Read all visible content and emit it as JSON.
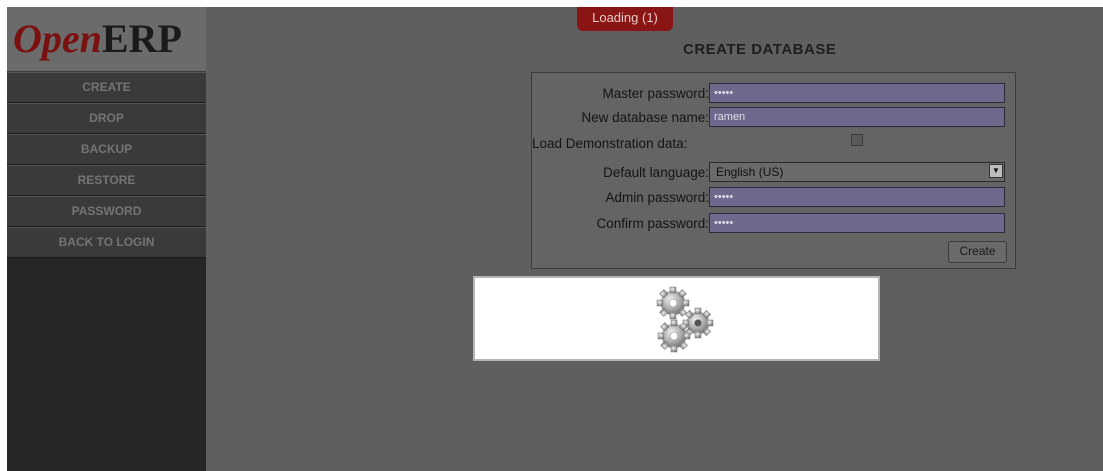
{
  "app": {
    "logo": {
      "open": "Open",
      "erp": "ERP"
    },
    "loading_badge": "Loading (1)"
  },
  "sidebar": {
    "items": [
      {
        "label": "CREATE"
      },
      {
        "label": "DROP"
      },
      {
        "label": "BACKUP"
      },
      {
        "label": "RESTORE"
      },
      {
        "label": "PASSWORD"
      },
      {
        "label": "BACK TO LOGIN"
      }
    ]
  },
  "form": {
    "title": "CREATE DATABASE",
    "fields": {
      "master_password": {
        "label": "Master password:",
        "value": "•••••"
      },
      "db_name": {
        "label": "New database name:",
        "value": "ramen"
      },
      "demo_data": {
        "label": "Load Demonstration data:",
        "checked": false
      },
      "language": {
        "label": "Default language:",
        "value": "English (US)"
      },
      "admin_password": {
        "label": "Admin password:",
        "value": "•••••"
      },
      "confirm_password": {
        "label": "Confirm password:",
        "value": "•••••"
      }
    },
    "create_label": "Create"
  },
  "colors": {
    "overlay_bg": "#5f5f5f",
    "loading_red": "#8a1515",
    "logo_red": "#7a1010",
    "input_bg": "#6e6a8e"
  },
  "icons": {
    "spinner": "gears-icon",
    "dropdown": "chevron-down-icon"
  }
}
